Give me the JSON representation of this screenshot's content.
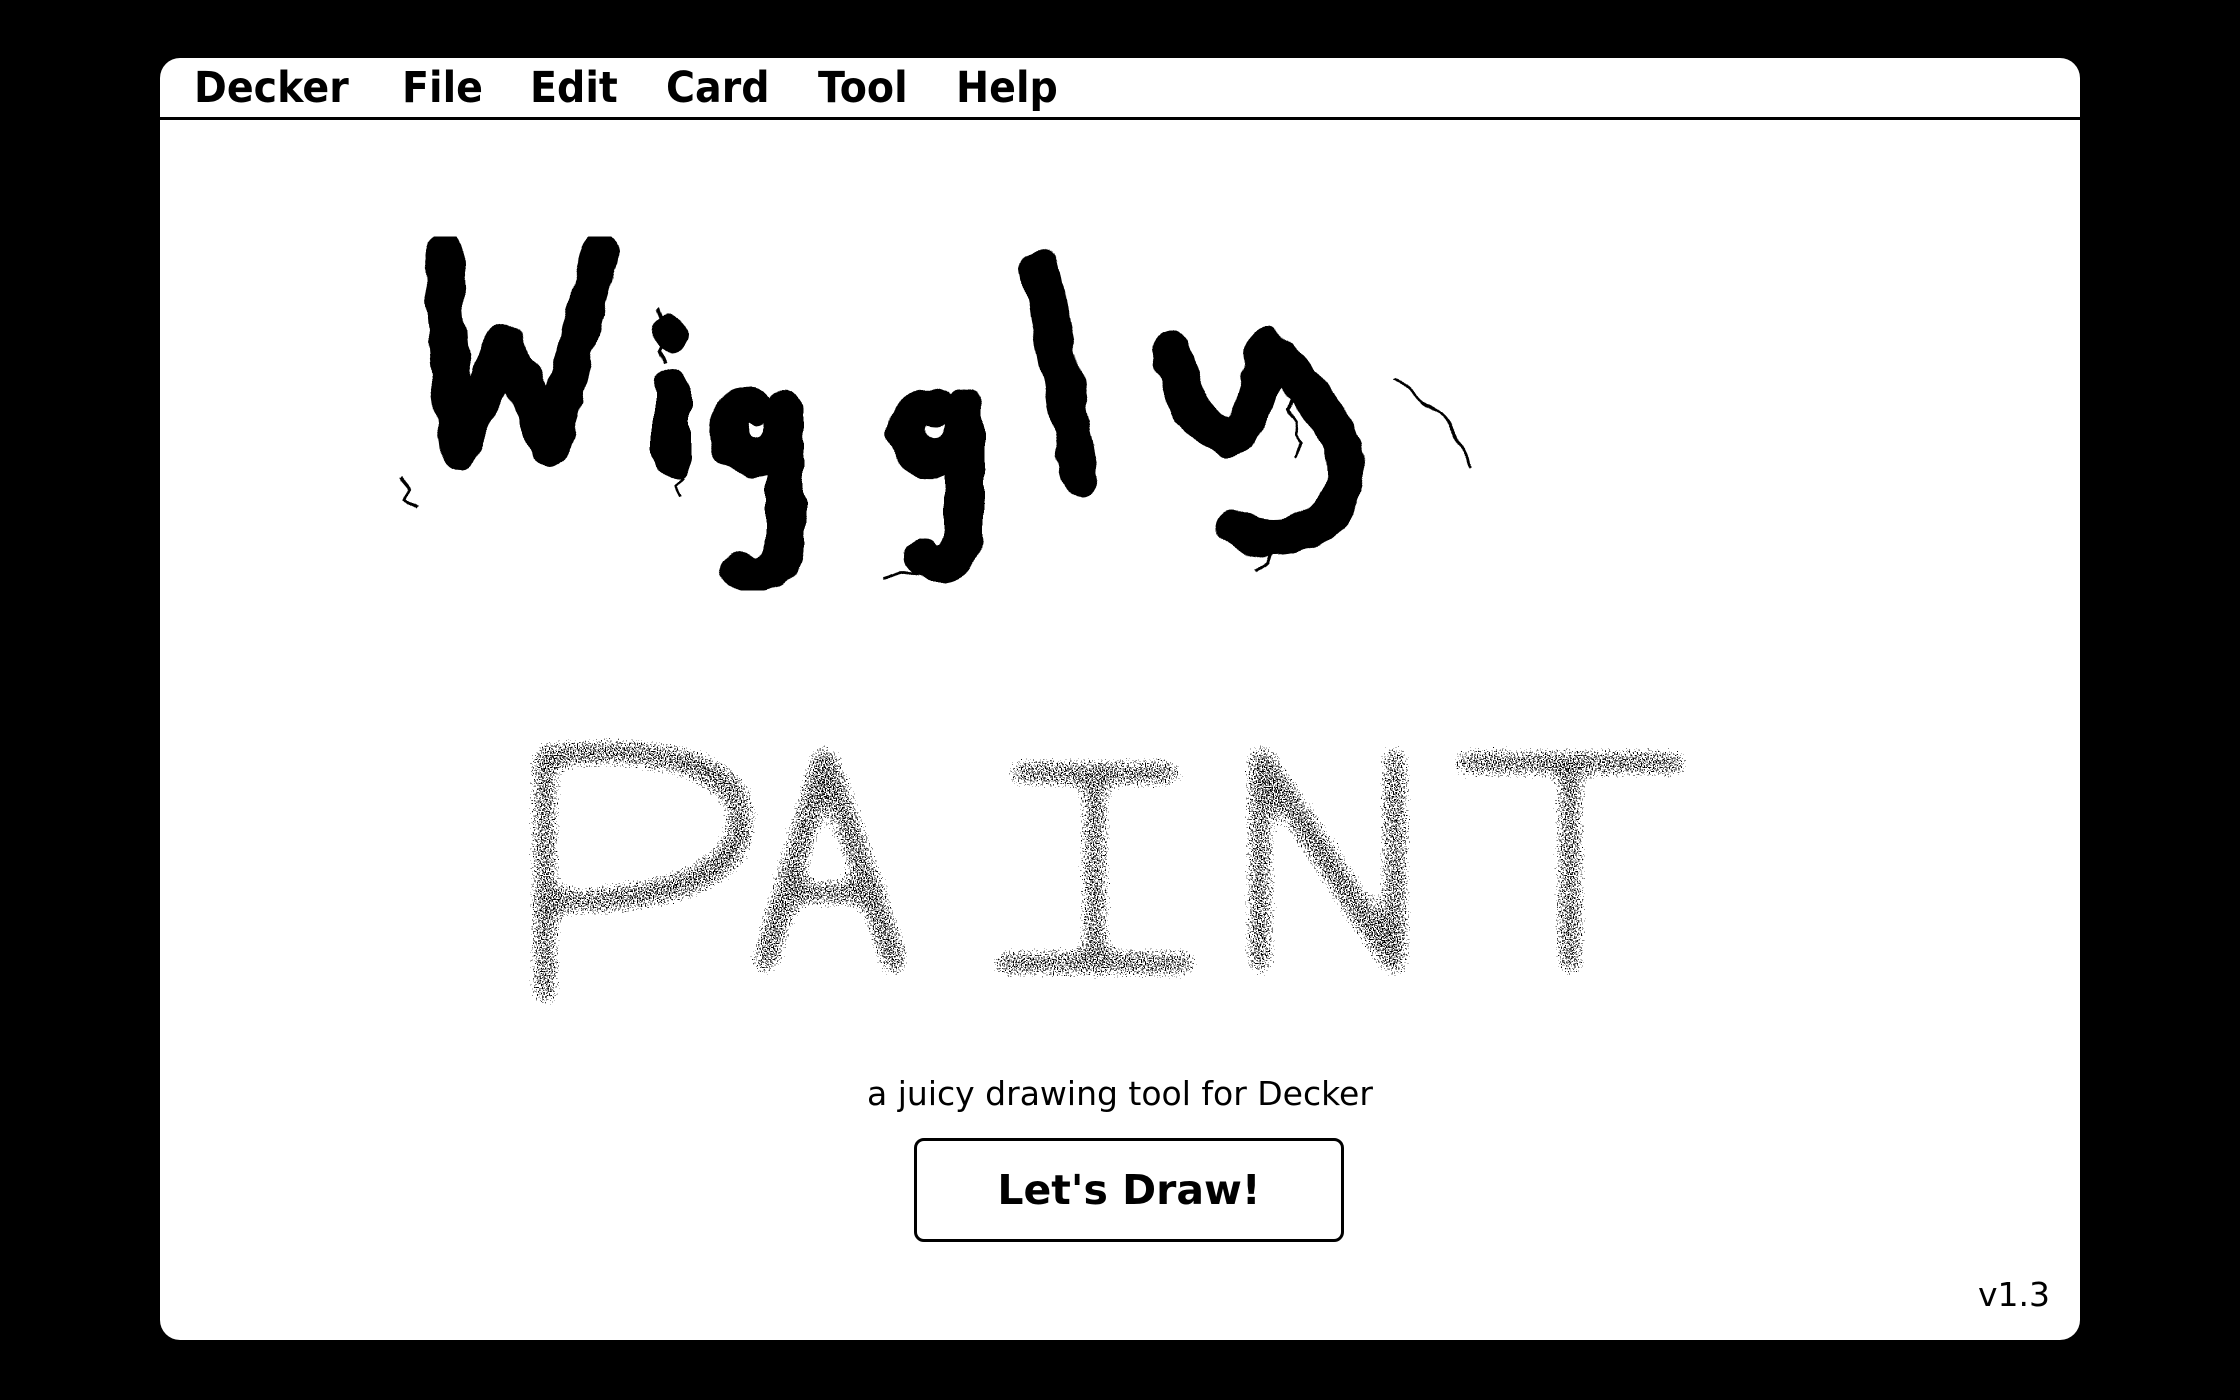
{
  "menubar": {
    "items": [
      "Decker",
      "File",
      "Edit",
      "Card",
      "Tool",
      "Help"
    ]
  },
  "title": {
    "line1": "Wiggly",
    "line2": "PAINT"
  },
  "subtitle": "a juicy drawing tool for Decker",
  "button": {
    "label": "Let's Draw!"
  },
  "version": "v1.3",
  "colors": {
    "background": "#000000",
    "screen": "#ffffff",
    "ink": "#000000"
  }
}
